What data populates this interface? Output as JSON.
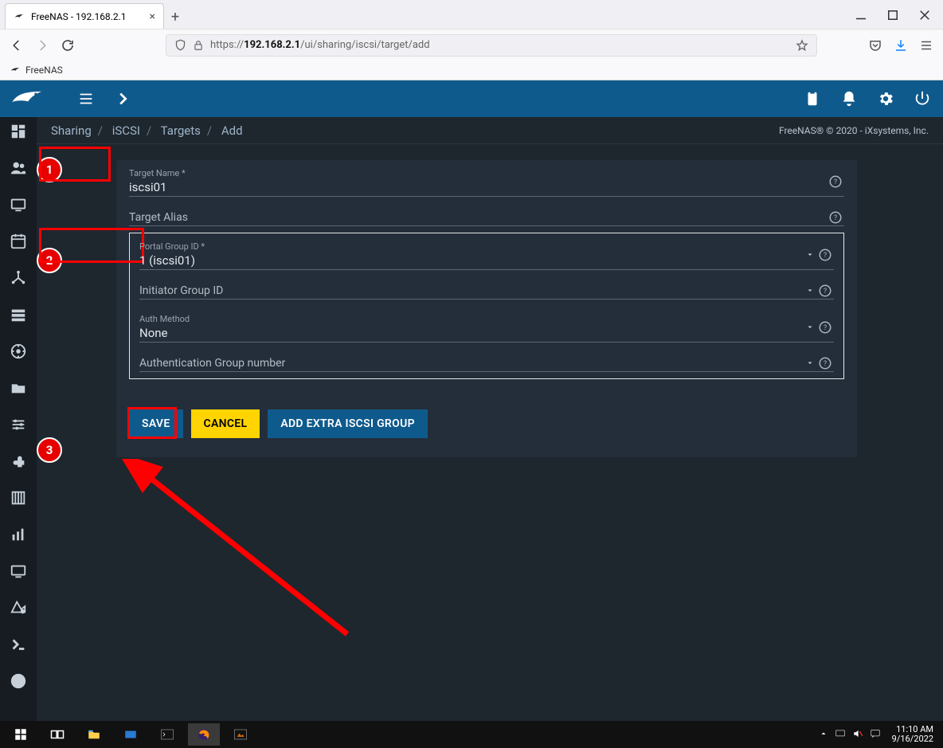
{
  "browser": {
    "tab_title": "FreeNAS - 192.168.2.1",
    "url_host": "192.168.2.1",
    "url_prefix": "https://",
    "url_path": "/ui/sharing/iscsi/target/add",
    "bookmark": "FreeNAS"
  },
  "topbar": {
    "icons": [
      "menu",
      "chevron-right",
      "clipboard",
      "bell",
      "gear",
      "power"
    ]
  },
  "breadcrumb": {
    "items": [
      "Sharing",
      "iSCSI",
      "Targets",
      "Add"
    ],
    "copyright": "FreeNAS® © 2020 - iXsystems, Inc."
  },
  "form": {
    "target_name": {
      "label": "Target Name *",
      "value": "iscsi01"
    },
    "target_alias": {
      "label": "Target Alias",
      "value": ""
    },
    "portal_group": {
      "label": "Portal Group ID *",
      "value": "1 (iscsi01)"
    },
    "initiator_group": {
      "label": "Initiator Group ID",
      "value": ""
    },
    "auth_method": {
      "label": "Auth Method",
      "value": "None"
    },
    "auth_group": {
      "label": "Authentication Group number",
      "value": ""
    }
  },
  "buttons": {
    "save": "SAVE",
    "cancel": "CANCEL",
    "add_extra": "ADD EXTRA ISCSI GROUP"
  },
  "callouts": {
    "one": "1",
    "two": "2",
    "three": "3"
  },
  "sidebar_items": [
    "dashboard",
    "accounts",
    "system",
    "tasks",
    "network",
    "storage",
    "directory",
    "sharing",
    "services",
    "plugins",
    "jails",
    "reporting",
    "vm",
    "display",
    "shell",
    "guide"
  ],
  "taskbar": {
    "time": "11:10 AM",
    "date": "9/16/2022"
  }
}
